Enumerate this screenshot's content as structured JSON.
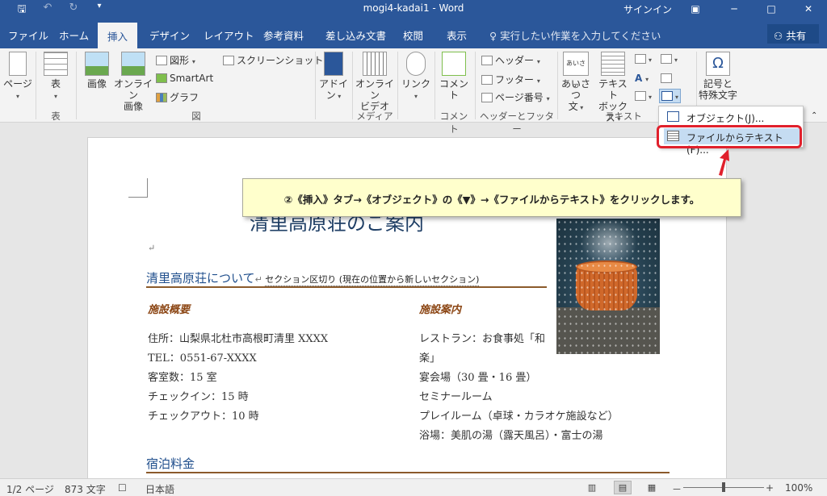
{
  "title_bar": {
    "save_icon": "save-icon",
    "undo_icon": "undo-icon",
    "redo_icon": "redo-icon",
    "customize_icon": "customize-qat-icon",
    "doc_title": "mogi4-kadai1  -  Word",
    "signin": "サインイン",
    "ribbon_options_icon": "ribbon-display-options-icon",
    "minimize": "─",
    "maximize": "□",
    "close": "✕"
  },
  "tabs": [
    "ファイル",
    "ホーム",
    "挿入",
    "デザイン",
    "レイアウト",
    "参考資料",
    "差し込み文書",
    "校閲",
    "表示"
  ],
  "active_tab": "挿入",
  "tell_me": "実行したい作業を入力してください",
  "share": "共有",
  "ribbon": {
    "page_button": "ページ",
    "table_button": "表",
    "group_table": "表",
    "picture_button": "画像",
    "online_picture_line1": "オンライン",
    "online_picture_line2": "画像",
    "shapes": "図形",
    "smartart": "SmartArt",
    "chart": "グラフ",
    "screenshot": "スクリーンショット",
    "group_illustrations": "図",
    "addin_line1": "アドイ",
    "addin_line2": "ン",
    "online_video_line1": "オンライン",
    "online_video_line2": "ビデオ",
    "group_media": "メディア",
    "link_button": "リンク",
    "comment_button": "コメント",
    "group_comment": "コメント",
    "header": "ヘッダー",
    "footer": "フッター",
    "page_number": "ページ番号",
    "group_header_footer": "ヘッダーとフッター",
    "greeting_line1": "あいさつ",
    "greeting_line2": "文",
    "greeting_icon_text": "あいさつ",
    "textbox_line1": "テキスト",
    "textbox_line2": "ボックス",
    "group_text": "テキスト",
    "symbol_line1": "記号と",
    "symbol_line2": "特殊文字",
    "symbol_icon": "Ω"
  },
  "dropdown": {
    "item_object": "オブジェクト(J)...",
    "item_text_from_file": "ファイルからテキスト(F)..."
  },
  "callout_text": "②《挿入》タブ→《オブジェクト》の《▼》→《ファイルからテキスト》をクリックします。",
  "document": {
    "title": "清里高原荘のご案内",
    "heading_about": "清里高原荘について",
    "section_break": "セクション区切り (現在の位置から新しいセクション)",
    "sub_overview": "施設概要",
    "sub_facilities": "施設案内",
    "overview": [
      "住所：山梨県北杜市高根町清里 XXXX",
      "TEL：0551-67-XXXX",
      "客室数：15 室",
      "チェックイン：15 時",
      "チェックアウト：10 時"
    ],
    "facilities": [
      "レストラン：お食事処「和",
      "楽」",
      "宴会場（30 畳・16 畳）",
      "セミナールーム",
      "プレイルーム（卓球・カラオケ施設など）",
      "浴場：美肌の湯（露天風呂）・富士の湯"
    ],
    "heading_rates": "宿泊料金",
    "para_mark": "↵"
  },
  "status": {
    "page": "1/2 ページ",
    "words": "873 文字",
    "language": "日本語",
    "zoom_minus": "－",
    "zoom_plus": "+",
    "zoom": "100%",
    "zoom_fraction": 0.5
  },
  "colors": {
    "accent": "#2b579a",
    "highlight": "#e0202c",
    "callout_bg": "#ffffcc",
    "heading": "#1f4e8c",
    "subheading": "#8b4513"
  }
}
